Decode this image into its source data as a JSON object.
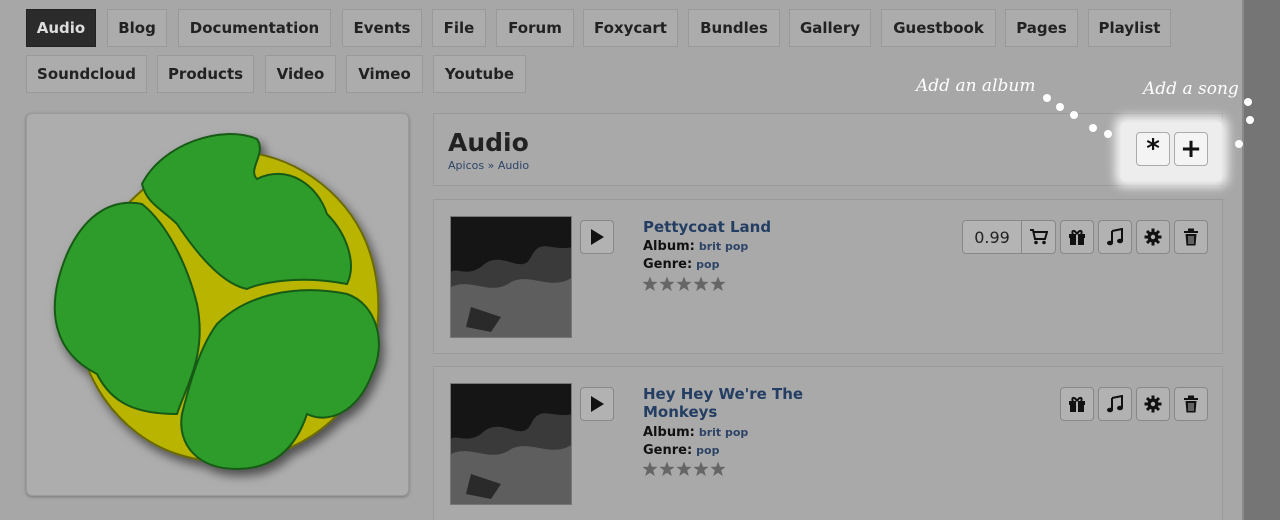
{
  "nav": {
    "tabs": [
      {
        "label": "Audio",
        "active": true
      },
      {
        "label": "Blog"
      },
      {
        "label": "Documentation"
      },
      {
        "label": "Events"
      },
      {
        "label": "File"
      },
      {
        "label": "Forum"
      },
      {
        "label": "Foxycart"
      },
      {
        "label": "Bundles"
      },
      {
        "label": "Gallery"
      },
      {
        "label": "Guestbook"
      },
      {
        "label": "Pages"
      },
      {
        "label": "Playlist"
      },
      {
        "label": "Soundcloud"
      },
      {
        "label": "Products"
      },
      {
        "label": "Video"
      },
      {
        "label": "Vimeo"
      },
      {
        "label": "Youtube"
      }
    ]
  },
  "header": {
    "title": "Audio",
    "breadcrumb": {
      "root": "Apicos",
      "separator": "»",
      "current": "Audio"
    },
    "add_album_symbol": "*",
    "add_song_symbol": "+"
  },
  "hints": {
    "add_album": "Add an album",
    "add_song": "Add a song"
  },
  "songs": [
    {
      "title": "Pettycoat Land",
      "album_label": "Album:",
      "album": "brit pop",
      "genre_label": "Genre:",
      "genre": "pop",
      "price": "0.99",
      "rating_stars": 5
    },
    {
      "title": "Hey Hey We're The Monkeys",
      "album_label": "Album:",
      "album": "brit pop",
      "genre_label": "Genre:",
      "genre": "pop",
      "rating_stars": 5
    }
  ],
  "colors": {
    "logo_green": "#2e9c2a",
    "logo_yellow": "#b9b400",
    "active_tab": "#2b2b2b",
    "link": "#243e63"
  },
  "icons": [
    "play-icon",
    "cart-icon",
    "gift-icon",
    "music-icon",
    "gear-icon",
    "trash-icon",
    "asterisk-icon",
    "plus-icon",
    "star-icon"
  ]
}
